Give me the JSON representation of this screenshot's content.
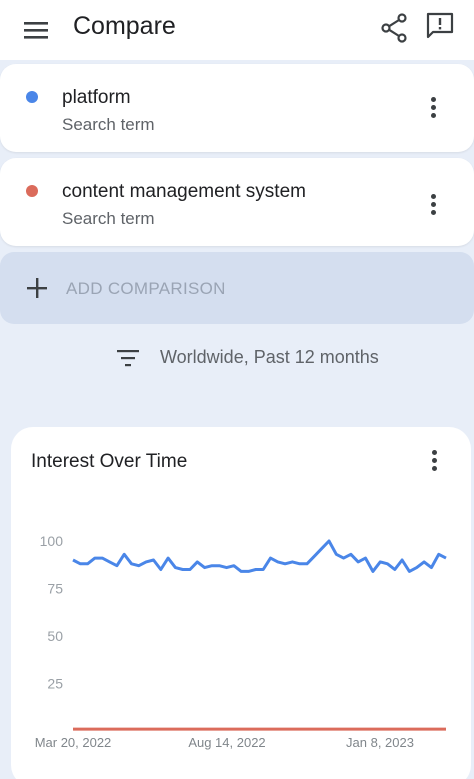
{
  "header": {
    "title": "Compare",
    "menu_icon": "hamburger-menu-icon",
    "share_icon": "share-icon",
    "feedback_icon": "feedback-icon"
  },
  "terms": [
    {
      "name": "platform",
      "subtitle": "Search term",
      "color": "#4a86e8"
    },
    {
      "name": "content management system",
      "subtitle": "Search term",
      "color": "#db6b5b"
    }
  ],
  "add_comparison": {
    "label": "ADD COMPARISON"
  },
  "filter": {
    "label": "Worldwide, Past 12 months"
  },
  "chart_card": {
    "title": "Interest Over Time"
  },
  "chart_data": {
    "type": "line",
    "title": "Interest Over Time",
    "y_ticks": [
      "100",
      "75",
      "50",
      "25"
    ],
    "ylim": [
      0,
      100
    ],
    "x_tick_labels": [
      "Mar 20, 2022",
      "Aug 14, 2022",
      "Jan 8, 2023"
    ],
    "grid": false,
    "series": [
      {
        "name": "platform",
        "color": "#4a86e8",
        "values": [
          90,
          88,
          88,
          91,
          91,
          89,
          87,
          93,
          88,
          87,
          89,
          90,
          85,
          91,
          86,
          85,
          85,
          89,
          86,
          87,
          87,
          86,
          87,
          84,
          84,
          85,
          85,
          91,
          89,
          88,
          89,
          88,
          88,
          92,
          96,
          100,
          93,
          91,
          93,
          89,
          91,
          84,
          89,
          88,
          85,
          90,
          84,
          86,
          89,
          86,
          93,
          91
        ]
      },
      {
        "name": "content management system",
        "color": "#db6b5b",
        "values": [
          1,
          1,
          1,
          1,
          1,
          1,
          1,
          1,
          1,
          1,
          1,
          1,
          1,
          1,
          1,
          1,
          1,
          1,
          1,
          1,
          1,
          1,
          1,
          1,
          1,
          1,
          1,
          1,
          1,
          1,
          1,
          1,
          1,
          1,
          1,
          1,
          1,
          1,
          1,
          1,
          1,
          1,
          1,
          1,
          1,
          1,
          1,
          1,
          1,
          1,
          1,
          1
        ]
      }
    ]
  }
}
